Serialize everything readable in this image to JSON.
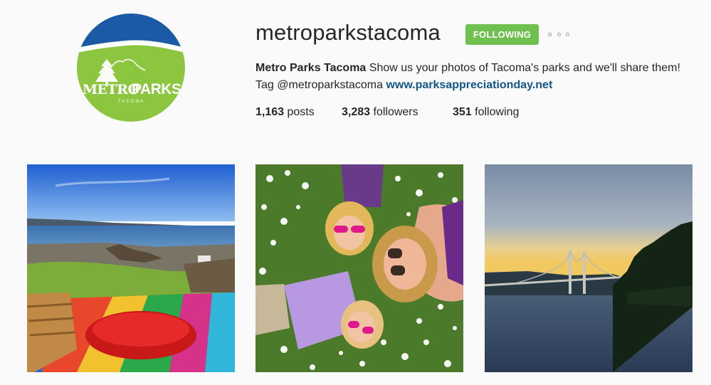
{
  "profile": {
    "username": "metroparkstacoma",
    "follow_button_label": "FOLLOWING",
    "full_name": "Metro Parks Tacoma",
    "bio_text": "Show us your photos of Tacoma's parks and we'll share them! Tag @metroparkstacoma",
    "website": "www.parksappreciationday.net",
    "avatar_logo_text": "METROPARKS",
    "avatar_logo_subtext": "TACOMA"
  },
  "stats": {
    "posts_count": "1,163",
    "posts_label": "posts",
    "followers_count": "3,283",
    "followers_label": "followers",
    "following_count": "351",
    "following_label": "following"
  },
  "colors": {
    "follow_button": "#70c050",
    "link": "#125688",
    "background": "#fafafa",
    "logo_green": "#8cc63f",
    "logo_blue": "#1b5aa6"
  },
  "icons": {
    "more_options": "ellipsis-icon"
  },
  "posts": [
    {
      "name": "post-beach-picnic"
    },
    {
      "name": "post-girls-in-daisies"
    },
    {
      "name": "post-narrows-bridge"
    }
  ]
}
